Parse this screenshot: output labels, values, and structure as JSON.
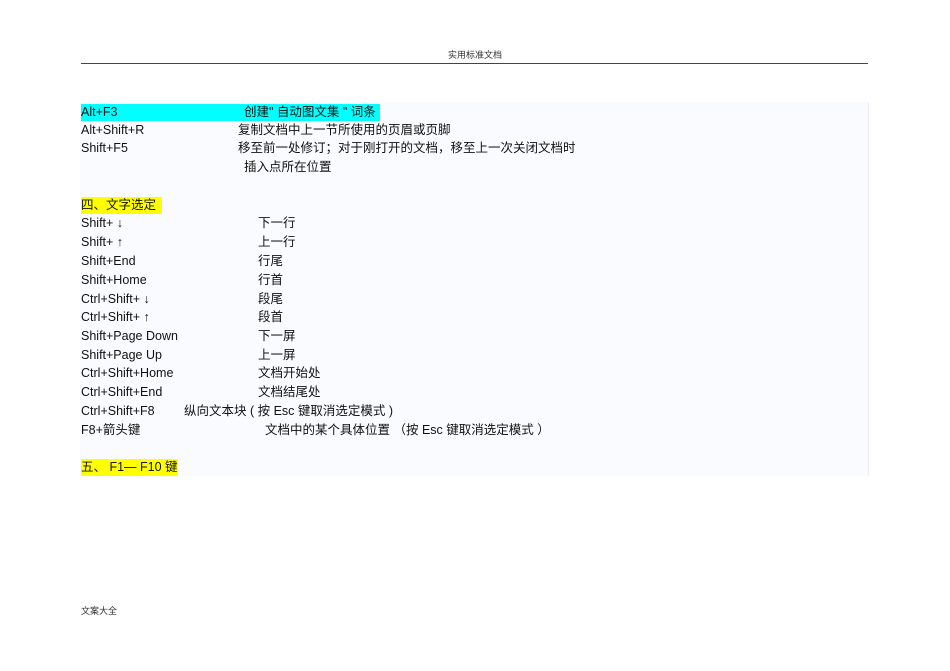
{
  "header": "实用标准文档",
  "footer": "文案大全",
  "rows": [
    {
      "key": "Alt+F3",
      "desc": "创建\" 自动图文集 \" 词条"
    },
    {
      "key": "Alt+Shift+R",
      "desc": "复制文档中上一节所使用的页眉或页脚"
    },
    {
      "key": "Shift+F5",
      "desc": "移至前一处修订；对于刚打开的文档，移至上一次关闭文档时",
      "desc2": "插入点所在位置"
    }
  ],
  "section4": "四、文字选定",
  "sel": [
    {
      "key": "Shift+ ↓",
      "desc": "下一行"
    },
    {
      "key": "Shift+ ↑",
      "desc": "上一行"
    },
    {
      "key": "Shift+End",
      "desc": "行尾"
    },
    {
      "key": "Shift+Home",
      "desc": "行首"
    },
    {
      "key": "Ctrl+Shift+ ↓",
      "desc": "段尾"
    },
    {
      "key": "Ctrl+Shift+ ↑",
      "desc": "段首"
    },
    {
      "key": "Shift+Page Down",
      "desc": "下一屏"
    },
    {
      "key": "Shift+Page Up",
      "desc": "上一屏"
    },
    {
      "key": "Ctrl+Shift+Home",
      "desc": "文档开始处"
    },
    {
      "key": "Ctrl+Shift+End",
      "desc": "文档结尾处"
    },
    {
      "key": "Ctrl+Shift+F8",
      "desc": "纵向文本块 ( 按 Esc  键取消选定模式 )"
    },
    {
      "key": "F8+箭头键",
      "desc": "文档中的某个具体位置 （按 Esc 键取消选定模式 ）"
    }
  ],
  "section5": "五、 F1— F10 键"
}
